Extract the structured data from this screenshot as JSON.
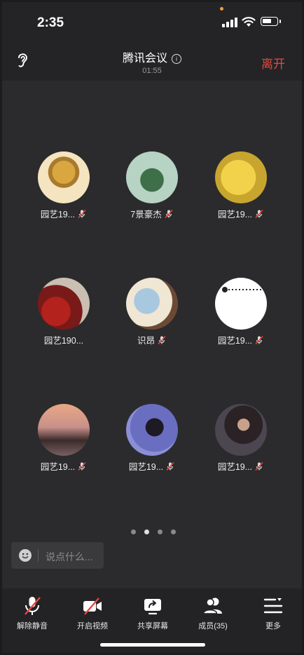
{
  "status": {
    "time": "2:35"
  },
  "header": {
    "title": "腾讯会议",
    "info_icon": "info-icon",
    "timer": "01:55",
    "leave_label": "离开"
  },
  "participants": [
    {
      "name": "园艺19...",
      "muted": true
    },
    {
      "name": "7景豪杰",
      "muted": true
    },
    {
      "name": "园艺19...",
      "muted": true
    },
    {
      "name": "园艺190...",
      "muted": false
    },
    {
      "name": "识昂",
      "muted": true
    },
    {
      "name": "园艺19...",
      "muted": true
    },
    {
      "name": "园艺19...",
      "muted": true
    },
    {
      "name": "园艺19...",
      "muted": true
    },
    {
      "name": "园艺19...",
      "muted": true
    }
  ],
  "pagination": {
    "pages": 4,
    "active": 2
  },
  "chat": {
    "placeholder": "说点什么..."
  },
  "toolbar": {
    "unmute": "解除静音",
    "video": "开启视频",
    "share": "共享屏幕",
    "members": "成员(35)",
    "more": "更多"
  },
  "colors": {
    "accent_leave": "#e8473e",
    "background": "#2b2b2d",
    "mute_slash": "#e8473e"
  }
}
